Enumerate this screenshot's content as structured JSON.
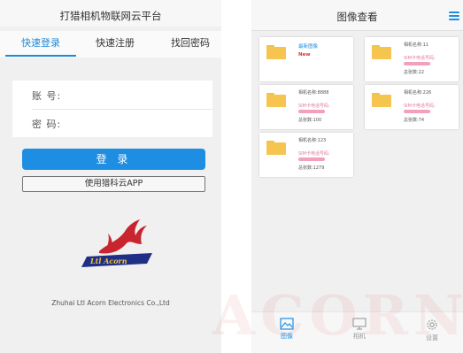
{
  "login_screen": {
    "title": "打猎相机物联网云平台",
    "tabs": [
      {
        "label": "快速登录",
        "active": true
      },
      {
        "label": "快速注册",
        "active": false
      },
      {
        "label": "找回密码",
        "active": false
      }
    ],
    "account_label": "账 号:",
    "account_value": "",
    "password_label": "密 码:",
    "password_value": "",
    "login_button": "登 录",
    "app_button": "使用猎科云APP",
    "logo_text": "Ltl Acorn",
    "company": "Zhuhai Ltl Acorn Electronics Co.,Ltd"
  },
  "image_view_screen": {
    "title": "图像查看",
    "menu_icon": "hamburger-icon",
    "cards": [
      {
        "name": "最新图像",
        "badge": "New",
        "sim_label": "",
        "count": ""
      },
      {
        "name": "相机名称:11",
        "badge": "",
        "sim_label": "SIM卡电话号码:",
        "count": "总张数:22"
      },
      {
        "name": "相机名称:8888",
        "badge": "",
        "sim_label": "SIM卡电话号码:",
        "count": "总张数:100"
      },
      {
        "name": "相机名称:226",
        "badge": "",
        "sim_label": "SIM卡电话号码:",
        "count": "总张数:74"
      },
      {
        "name": "相机名称:123",
        "badge": "",
        "sim_label": "SIM卡电话号码:",
        "count": "总张数:1279"
      }
    ],
    "bottom_nav": [
      {
        "label": "图像",
        "icon": "image-icon",
        "active": true
      },
      {
        "label": "相机",
        "icon": "monitor-icon",
        "active": false
      },
      {
        "label": "设置",
        "icon": "gear-icon",
        "active": false
      }
    ]
  },
  "colors": {
    "accent": "#1e8ee2",
    "folder": "#f5c54f",
    "new_badge": "#e03030",
    "redaction": "#f2a0bd"
  },
  "watermark": "ACORN"
}
